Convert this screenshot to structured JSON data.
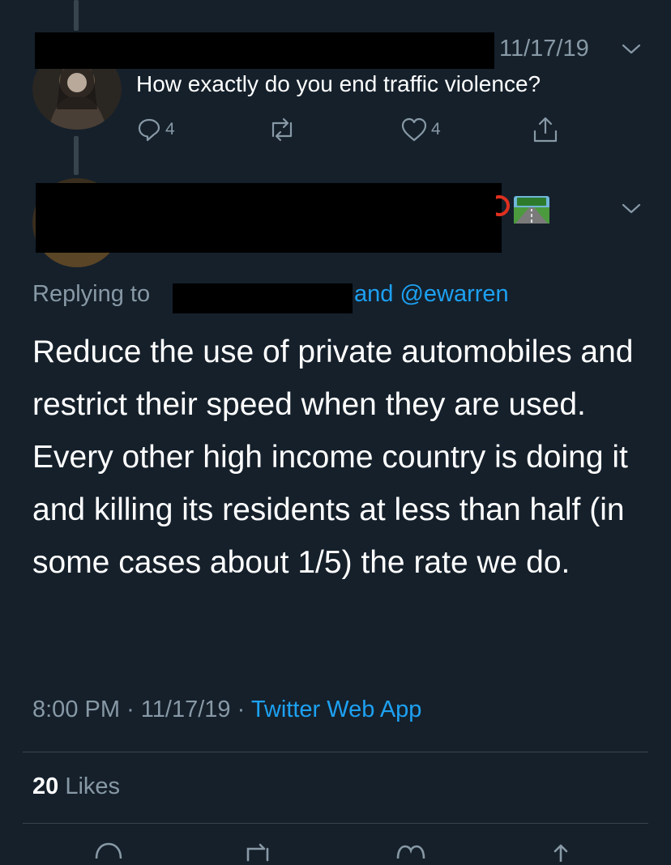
{
  "parent_tweet": {
    "date": "11/17/19",
    "text": "How exactly do you end traffic violence?",
    "replies": "4",
    "likes": "4"
  },
  "main_tweet": {
    "replying_label": "Replying to",
    "replying_tail": "and @ewarren",
    "text": "Reduce the use of private automobiles and restrict their speed when they are used. Every other high income country is doing it and killing its residents at less than half (in some cases about 1/5) the rate we do.",
    "time": "8:00 PM",
    "sep1": "·",
    "date": "11/17/19",
    "sep2": "·",
    "source": "Twitter Web App",
    "likes_count": "20",
    "likes_label": "Likes"
  },
  "icons": [
    "reply-icon",
    "retweet-icon",
    "like-icon",
    "share-icon",
    "chevron-down-icon",
    "motorway-emoji"
  ],
  "colors": {
    "background": "#15202b",
    "muted": "#8899a6",
    "accent": "#1da1f2",
    "divider": "#38444d"
  }
}
